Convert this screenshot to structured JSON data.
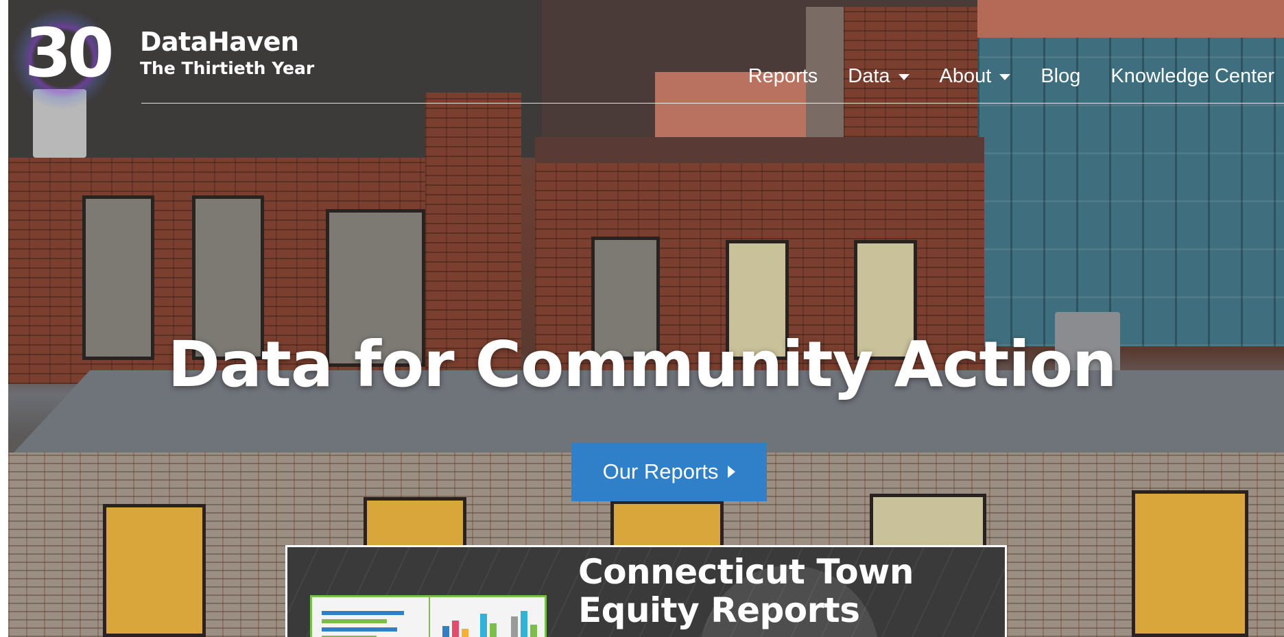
{
  "brand": {
    "logo_number": "30",
    "name": "DataHaven",
    "tagline": "The Thirtieth Year"
  },
  "nav": {
    "items": [
      {
        "label": "Reports",
        "has_dropdown": false
      },
      {
        "label": "Data",
        "has_dropdown": true
      },
      {
        "label": "About",
        "has_dropdown": true
      },
      {
        "label": "Blog",
        "has_dropdown": false
      },
      {
        "label": "Knowledge Center",
        "has_dropdown": false
      }
    ]
  },
  "hero": {
    "headline": "Data for Community Action",
    "cta_label": "Our Reports"
  },
  "feature": {
    "title": "Connecticut Town Equity Reports"
  },
  "colors": {
    "cta_blue": "#2f7fc9",
    "text": "#ffffff",
    "thumb_accent": "#7bbf4a"
  }
}
